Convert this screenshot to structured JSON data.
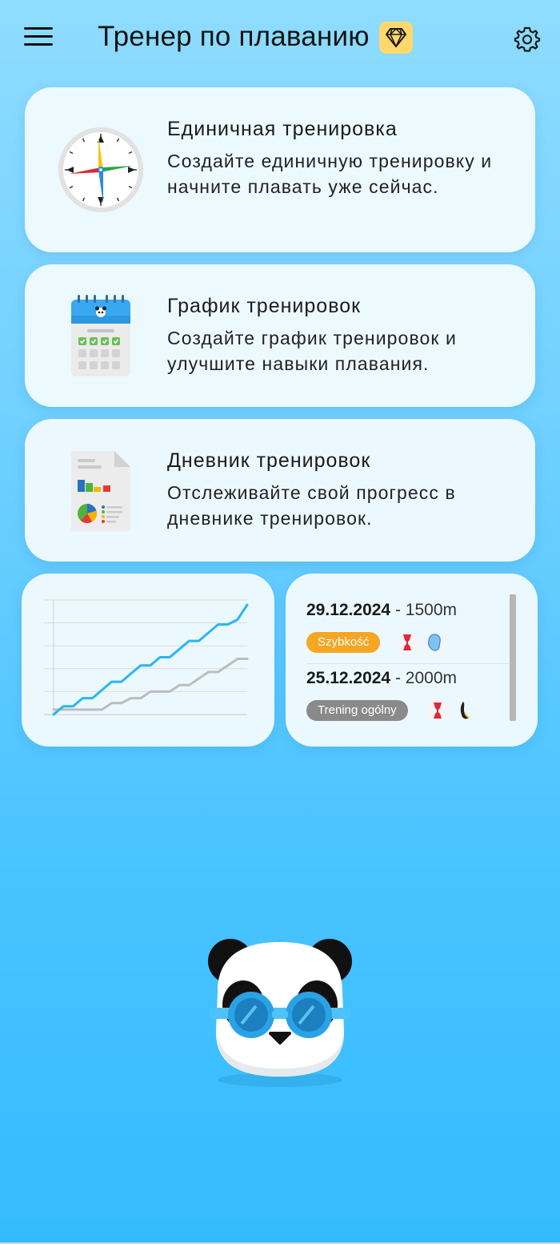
{
  "header": {
    "title": "Тренер по плаванию",
    "menu_icon": "hamburger-menu-icon",
    "premium_icon": "diamond-icon",
    "settings_icon": "gear-icon"
  },
  "cards": [
    {
      "title": "Единичная тренировка",
      "description": "Создайте единичную тренировку и начните плавать уже сейчас.",
      "icon": "stopwatch-icon"
    },
    {
      "title": "График тренировок",
      "description": "Создайте график тренировок и улучшите навыки плавания.",
      "icon": "calendar-icon"
    },
    {
      "title": "Дневник тренировок",
      "description": "Отслеживайте свой прогресс в дневнике тренировок.",
      "icon": "report-document-icon"
    }
  ],
  "chart_data": {
    "type": "line",
    "title": "",
    "xlabel": "",
    "ylabel": "",
    "grid": true,
    "x": [
      0,
      1,
      2,
      3,
      4,
      5,
      6,
      7,
      8,
      9,
      10,
      11,
      12,
      13,
      14,
      15,
      16,
      17,
      18,
      19,
      20
    ],
    "series": [
      {
        "color": "#2bb6f0",
        "values": [
          0.0,
          0.5,
          0.5,
          1.0,
          1.0,
          1.5,
          2.0,
          2.0,
          2.5,
          3.0,
          3.0,
          3.5,
          3.5,
          4.0,
          4.5,
          4.5,
          5.0,
          5.5,
          5.5,
          5.8,
          6.7
        ]
      },
      {
        "color": "#bdbdbd",
        "values": [
          0.3,
          0.3,
          0.3,
          0.3,
          0.3,
          0.3,
          0.7,
          0.7,
          1.0,
          1.0,
          1.4,
          1.4,
          1.4,
          1.8,
          1.8,
          2.2,
          2.6,
          2.6,
          3.0,
          3.4,
          3.4
        ]
      }
    ]
  },
  "log": {
    "entries": [
      {
        "date": "29.12.2024",
        "distance": "1500m",
        "tag": "Szybkość",
        "tag_color": "#f5a623",
        "icons": [
          "pull-buoy-icon",
          "kickboard-icon"
        ]
      },
      {
        "date": "25.12.2024",
        "distance": "2000m",
        "tag": "Trening ogólny",
        "tag_color": "#8a8a8a",
        "icons": [
          "pull-buoy-icon",
          "fin-icon"
        ]
      }
    ],
    "separator": " - "
  },
  "mascot": {
    "icon": "panda-goggles-mascot"
  }
}
